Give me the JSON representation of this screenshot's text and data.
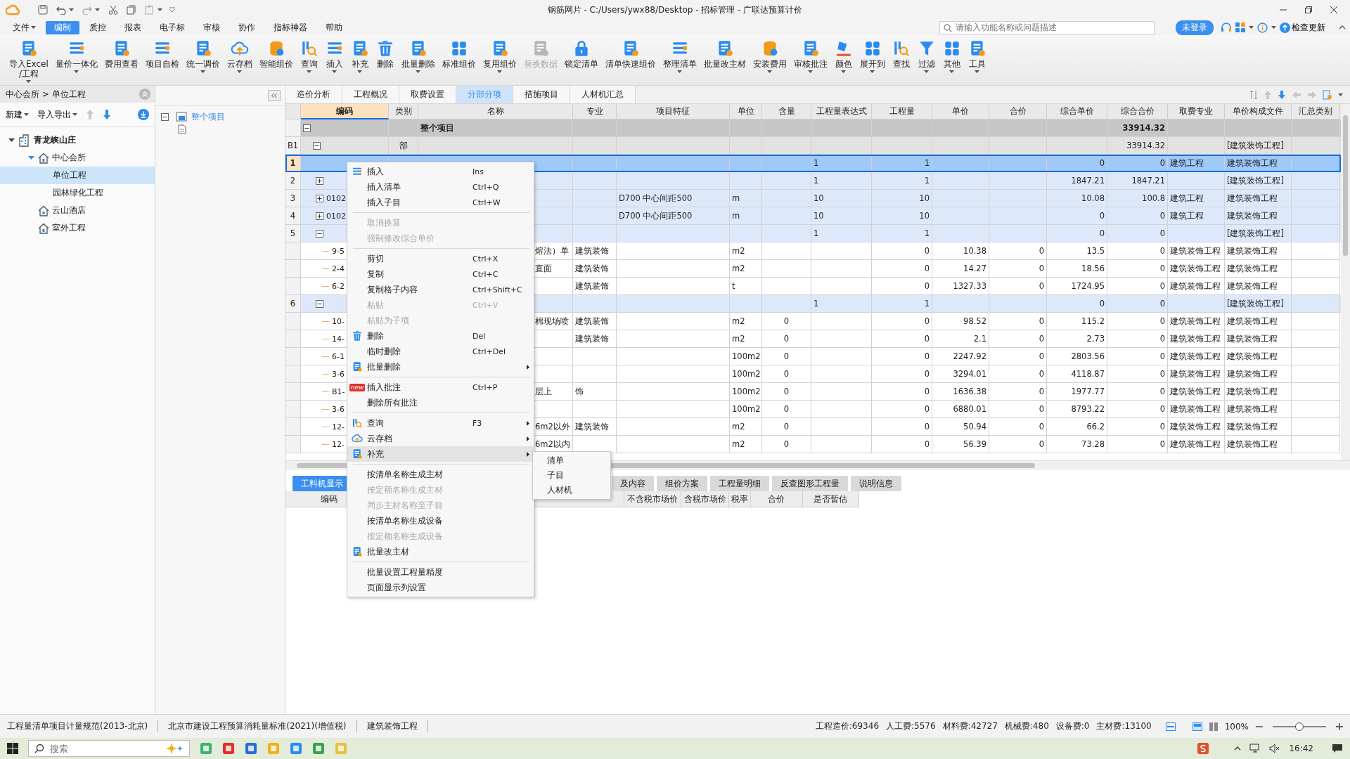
{
  "title_bar": {
    "title": "钢筋网片 - C:/Users/ywx88/Desktop - 招标管理 - 广联达预算计价"
  },
  "menu_tabs": [
    {
      "label": "文件",
      "selected": false,
      "dropdown": true
    },
    {
      "label": "编制",
      "selected": true,
      "dropdown": false
    },
    {
      "label": "质控",
      "selected": false,
      "dropdown": false
    },
    {
      "label": "报表",
      "selected": false,
      "dropdown": false
    },
    {
      "label": "电子标",
      "selected": false,
      "dropdown": false
    },
    {
      "label": "审核",
      "selected": false,
      "dropdown": false
    },
    {
      "label": "协作",
      "selected": false,
      "dropdown": false
    },
    {
      "label": "指标神器",
      "selected": false,
      "dropdown": false
    },
    {
      "label": "帮助",
      "selected": false,
      "dropdown": false
    }
  ],
  "search": {
    "placeholder": "请输入功能名称或问题描述"
  },
  "login_button": "未登录",
  "update_button": "检查更新",
  "ribbon": [
    {
      "label": "导入Excel\n/工程",
      "dropdown": true,
      "disabled": false
    },
    {
      "label": "量价一体化",
      "dropdown": true,
      "disabled": false
    },
    {
      "label": "费用查看",
      "dropdown": false,
      "disabled": false
    },
    {
      "label": "项目自检",
      "dropdown": false,
      "disabled": false
    },
    {
      "label": "统一调价",
      "dropdown": true,
      "disabled": false
    },
    {
      "label": "云存档",
      "dropdown": true,
      "disabled": false
    },
    {
      "label": "智能组价",
      "dropdown": false,
      "disabled": false
    },
    {
      "label": "查询",
      "dropdown": true,
      "disabled": false
    },
    {
      "label": "插入",
      "dropdown": true,
      "disabled": false
    },
    {
      "label": "补充",
      "dropdown": true,
      "disabled": false
    },
    {
      "label": "删除",
      "dropdown": false,
      "disabled": false
    },
    {
      "label": "批量删除",
      "dropdown": true,
      "disabled": false
    },
    {
      "label": "标准组价",
      "dropdown": false,
      "disabled": false
    },
    {
      "label": "复用组价",
      "dropdown": true,
      "disabled": false
    },
    {
      "label": "替换数据",
      "dropdown": false,
      "disabled": true
    },
    {
      "label": "锁定清单",
      "dropdown": false,
      "disabled": false
    },
    {
      "label": "清单快速组价",
      "dropdown": false,
      "disabled": false
    },
    {
      "label": "整理清单",
      "dropdown": true,
      "disabled": false
    },
    {
      "label": "批量改主材",
      "dropdown": false,
      "disabled": false
    },
    {
      "label": "安装费用",
      "dropdown": true,
      "disabled": false
    },
    {
      "label": "审核批注",
      "dropdown": true,
      "disabled": false
    },
    {
      "label": "颜色",
      "dropdown": true,
      "disabled": false
    },
    {
      "label": "展开到",
      "dropdown": true,
      "disabled": false
    },
    {
      "label": "查找",
      "dropdown": false,
      "disabled": false
    },
    {
      "label": "过滤",
      "dropdown": true,
      "disabled": false
    },
    {
      "label": "其他",
      "dropdown": true,
      "disabled": false
    },
    {
      "label": "工具",
      "dropdown": true,
      "disabled": false
    }
  ],
  "breadcrumb": "中心会所 > 单位工程",
  "left_toolbar": [
    {
      "label": "新建"
    },
    {
      "label": "导入导出"
    }
  ],
  "project_tree": [
    {
      "label": "青龙峡山庄",
      "selected": false,
      "expanded": true,
      "children": [
        {
          "label": "中心会所",
          "selected": false,
          "expanded": true,
          "children": [
            {
              "label": "单位工程",
              "selected": true
            },
            {
              "label": "园林绿化工程",
              "selected": false
            }
          ]
        },
        {
          "label": "云山酒店",
          "selected": false
        },
        {
          "label": "室外工程",
          "selected": false
        }
      ]
    }
  ],
  "section_tree": {
    "label": "整个项目",
    "expanded": true
  },
  "view_tabs": [
    {
      "label": "造价分析",
      "selected": false
    },
    {
      "label": "工程概况",
      "selected": false
    },
    {
      "label": "取费设置",
      "selected": false
    },
    {
      "label": "分部分项",
      "selected": true
    },
    {
      "label": "措施项目",
      "selected": false
    },
    {
      "label": "人材机汇总",
      "selected": false
    }
  ],
  "table": {
    "columns": [
      {
        "label": "编码",
        "selected": true
      },
      {
        "label": "类别",
        "selected": false
      },
      {
        "label": "名称",
        "selected": false
      },
      {
        "label": "专业",
        "selected": false
      },
      {
        "label": "项目特征",
        "selected": false
      },
      {
        "label": "单位",
        "selected": false
      },
      {
        "label": "含量",
        "selected": false
      },
      {
        "label": "工程量表达式",
        "selected": false
      },
      {
        "label": "工程量",
        "selected": false
      },
      {
        "label": "单价",
        "selected": false
      },
      {
        "label": "合价",
        "selected": false
      },
      {
        "label": "综合单价",
        "selected": false
      },
      {
        "label": "综合合价",
        "selected": false
      },
      {
        "label": "取费专业",
        "selected": false
      },
      {
        "label": "单价构成文件",
        "selected": false
      },
      {
        "label": "汇总类别",
        "selected": false
      }
    ],
    "rows": [
      {
        "kind": "root",
        "selected": false,
        "expanded": true,
        "name": "整个项目",
        "unit_total": "33914.32"
      },
      {
        "kind": "part",
        "number": "B1",
        "selected": false,
        "expanded": true,
        "category": "部",
        "unit_total": "33914.32",
        "price_file": "[建筑装饰工程]"
      },
      {
        "kind": "item",
        "number": "1",
        "selected": true,
        "expr": "1",
        "qty": "1",
        "unit_price": "0",
        "unit_total": "0",
        "fee_specialty": "建筑工程",
        "price_file": "建筑装饰工程"
      },
      {
        "kind": "item",
        "number": "2",
        "selected": false,
        "expanded": false,
        "expr": "1",
        "qty": "1",
        "unit_price": "1847.21",
        "unit_total": "1847.21",
        "price_file": "[建筑装饰工程]"
      },
      {
        "kind": "item",
        "number": "3",
        "selected": false,
        "expanded": false,
        "code": "0102",
        "feature": "D700 中心间距500",
        "unit": "m",
        "expr": "10",
        "qty": "10",
        "unit_price": "10.08",
        "unit_total": "100.8",
        "fee_specialty": "建筑工程",
        "price_file": "建筑装饰工程"
      },
      {
        "kind": "item",
        "number": "4",
        "selected": false,
        "expanded": false,
        "code": "0102",
        "feature": "D700 中心间距500",
        "unit": "m",
        "expr": "10",
        "qty": "10",
        "unit_price": "0",
        "unit_total": "0",
        "fee_specialty": "建筑工程",
        "price_file": "建筑装饰工程"
      },
      {
        "kind": "item",
        "number": "5",
        "selected": false,
        "expanded": true,
        "expr": "1",
        "qty": "1",
        "unit_price": "0",
        "unit_total": "0",
        "price_file": "[建筑装饰工程]"
      },
      {
        "kind": "sub",
        "selected": false,
        "code": "9-5",
        "name": "熔法）单",
        "specialty": "建筑装饰",
        "unit": "m2",
        "qty": "0",
        "price": "10.38",
        "total": "0",
        "unit_price": "13.5",
        "unit_total": "0",
        "fee_specialty": "建筑装饰工程",
        "price_file": "建筑装饰工程"
      },
      {
        "kind": "sub",
        "selected": false,
        "code": "2-4",
        "name": "直面",
        "specialty": "建筑装饰",
        "unit": "m2",
        "qty": "0",
        "price": "14.27",
        "total": "0",
        "unit_price": "18.56",
        "unit_total": "0",
        "fee_specialty": "建筑装饰工程",
        "price_file": "建筑装饰工程"
      },
      {
        "kind": "sub",
        "selected": false,
        "code": "6-2",
        "specialty": "建筑装饰",
        "unit": "t",
        "qty": "0",
        "price": "1327.33",
        "total": "0",
        "unit_price": "1724.95",
        "unit_total": "0",
        "fee_specialty": "建筑装饰工程",
        "price_file": "建筑装饰工程"
      },
      {
        "kind": "item",
        "number": "6",
        "selected": false,
        "expanded": true,
        "expr": "1",
        "qty": "1",
        "unit_price": "0",
        "unit_total": "0",
        "price_file": "[建筑装饰工程]"
      },
      {
        "kind": "sub",
        "selected": false,
        "code": "10-",
        "name": "棉现场喷",
        "specialty": "建筑装饰",
        "unit": "m2",
        "content": "0",
        "qty": "0",
        "price": "98.52",
        "total": "0",
        "unit_price": "115.2",
        "unit_total": "0",
        "fee_specialty": "建筑装饰工程",
        "price_file": "建筑装饰工程"
      },
      {
        "kind": "sub",
        "selected": false,
        "code": "14-",
        "specialty": "建筑装饰",
        "unit": "m2",
        "content": "0",
        "qty": "0",
        "price": "2.1",
        "total": "0",
        "unit_price": "2.73",
        "unit_total": "0",
        "fee_specialty": "建筑装饰工程",
        "price_file": "建筑装饰工程"
      },
      {
        "kind": "sub",
        "selected": false,
        "code": "6-1",
        "unit": "100m2",
        "content": "0",
        "qty": "0",
        "price": "2247.92",
        "total": "0",
        "unit_price": "2803.56",
        "unit_total": "0",
        "fee_specialty": "建筑装饰工程",
        "price_file": "建筑装饰工程"
      },
      {
        "kind": "sub",
        "selected": false,
        "code": "3-6",
        "unit": "100m2",
        "content": "0",
        "qty": "0",
        "price": "3294.01",
        "total": "0",
        "unit_price": "4118.87",
        "unit_total": "0",
        "fee_specialty": "建筑装饰工程",
        "price_file": "建筑装饰工程"
      },
      {
        "kind": "sub",
        "selected": false,
        "code": "B1-",
        "name": "层上",
        "specialty": "饰",
        "unit": "100m2",
        "content": "0",
        "qty": "0",
        "price": "1636.38",
        "total": "0",
        "unit_price": "1977.77",
        "unit_total": "0",
        "fee_specialty": "建筑装饰工程",
        "price_file": "建筑装饰工程"
      },
      {
        "kind": "sub",
        "selected": false,
        "code": "3-6",
        "unit": "100m2",
        "content": "0",
        "qty": "0",
        "price": "6880.01",
        "total": "0",
        "unit_price": "8793.22",
        "unit_total": "0",
        "fee_specialty": "建筑装饰工程",
        "price_file": "建筑装饰工程"
      },
      {
        "kind": "sub",
        "selected": false,
        "code": "12-",
        "name": "6m2以外",
        "specialty": "建筑装饰",
        "unit": "m2",
        "content": "0",
        "qty": "0",
        "price": "50.94",
        "total": "0",
        "unit_price": "66.2",
        "unit_total": "0",
        "fee_specialty": "建筑装饰工程",
        "price_file": "建筑装饰工程"
      },
      {
        "kind": "sub",
        "selected": false,
        "code": "12-",
        "name": "6m2以内",
        "unit": "m2",
        "content": "0",
        "qty": "0",
        "price": "56.39",
        "total": "0",
        "unit_price": "73.28",
        "unit_total": "0",
        "fee_specialty": "建筑装饰工程",
        "price_file": "建筑装饰工程"
      }
    ]
  },
  "bottom_tabs": [
    {
      "label": "工料机显示",
      "selected": true
    },
    {
      "label": "及内容",
      "selected": false
    },
    {
      "label": "组价方案",
      "selected": false
    },
    {
      "label": "工程量明细",
      "selected": false
    },
    {
      "label": "反查图形工程量",
      "selected": false
    },
    {
      "label": "说明信息",
      "selected": false
    }
  ],
  "bottom_columns": [
    "编码",
    "不含税市场价",
    "含税市场价",
    "税率",
    "合价",
    "是否暂估"
  ],
  "context_menu": [
    {
      "kind": "item",
      "label": "插入",
      "shortcut": "Ins",
      "disabled": false,
      "submenu": false,
      "selected": false
    },
    {
      "kind": "item",
      "label": "插入清单",
      "shortcut": "Ctrl+Q",
      "disabled": false,
      "submenu": false,
      "selected": false
    },
    {
      "kind": "item",
      "label": "插入子目",
      "shortcut": "Ctrl+W",
      "disabled": false,
      "submenu": false,
      "selected": false
    },
    {
      "kind": "separator"
    },
    {
      "kind": "item",
      "label": "取消换算",
      "disabled": true,
      "submenu": false,
      "selected": false
    },
    {
      "kind": "item",
      "label": "强制修改综合单价",
      "disabled": true,
      "submenu": false,
      "selected": false
    },
    {
      "kind": "separator"
    },
    {
      "kind": "item",
      "label": "剪切",
      "shortcut": "Ctrl+X",
      "disabled": false,
      "submenu": false,
      "selected": false
    },
    {
      "kind": "item",
      "label": "复制",
      "shortcut": "Ctrl+C",
      "disabled": false,
      "submenu": false,
      "selected": false
    },
    {
      "kind": "item",
      "label": "复制格子内容",
      "shortcut": "Ctrl+Shift+C",
      "disabled": false,
      "submenu": false,
      "selected": false
    },
    {
      "kind": "item",
      "label": "粘贴",
      "shortcut": "Ctrl+V",
      "disabled": true,
      "submenu": false,
      "selected": false
    },
    {
      "kind": "item",
      "label": "粘贴为子项",
      "disabled": true,
      "submenu": false,
      "selected": false
    },
    {
      "kind": "item",
      "label": "删除",
      "shortcut": "Del",
      "disabled": false,
      "submenu": false,
      "selected": false
    },
    {
      "kind": "item",
      "label": "临时删除",
      "shortcut": "Ctrl+Del",
      "disabled": false,
      "submenu": false,
      "selected": false
    },
    {
      "kind": "item",
      "label": "批量删除",
      "disabled": false,
      "submenu": true,
      "selected": false
    },
    {
      "kind": "separator"
    },
    {
      "kind": "item",
      "label": "插入批注",
      "shortcut": "Ctrl+P",
      "badge": "new",
      "disabled": false,
      "submenu": false,
      "selected": false
    },
    {
      "kind": "item",
      "label": "删除所有批注",
      "disabled": false,
      "submenu": false,
      "selected": false
    },
    {
      "kind": "separator"
    },
    {
      "kind": "item",
      "label": "查询",
      "shortcut": "F3",
      "disabled": false,
      "submenu": true,
      "selected": false
    },
    {
      "kind": "item",
      "label": "云存档",
      "disabled": false,
      "submenu": true,
      "selected": false
    },
    {
      "kind": "item",
      "label": "补充",
      "disabled": false,
      "submenu": true,
      "selected": true
    },
    {
      "kind": "separator"
    },
    {
      "kind": "item",
      "label": "按清单名称生成主材",
      "disabled": false,
      "submenu": false,
      "selected": false
    },
    {
      "kind": "item",
      "label": "按定额名称生成主材",
      "disabled": true,
      "submenu": false,
      "selected": false
    },
    {
      "kind": "item",
      "label": "同步主材名称至子目",
      "disabled": true,
      "submenu": false,
      "selected": false
    },
    {
      "kind": "item",
      "label": "按清单名称生成设备",
      "disabled": false,
      "submenu": false,
      "selected": false
    },
    {
      "kind": "item",
      "label": "按定额名称生成设备",
      "disabled": true,
      "submenu": false,
      "selected": false
    },
    {
      "kind": "item",
      "label": "批量改主材",
      "disabled": false,
      "submenu": false,
      "selected": false
    },
    {
      "kind": "separator"
    },
    {
      "kind": "item",
      "label": "批量设置工程量精度",
      "disabled": false,
      "submenu": false,
      "selected": false
    },
    {
      "kind": "item",
      "label": "页面显示列设置",
      "disabled": false,
      "submenu": false,
      "selected": false
    }
  ],
  "submenu": [
    {
      "label": "清单"
    },
    {
      "label": "子目"
    },
    {
      "label": "人材机"
    }
  ],
  "status_bar": {
    "left": [
      "工程量清单项目计量规范(2013-北京)",
      "北京市建设工程预算消耗量标准(2021)(增值税)",
      "建筑装饰工程"
    ],
    "right": [
      "工程造价:69346",
      "人工费:5576",
      "材料费:42727",
      "机械费:480",
      "设备费:0",
      "主材费:13100"
    ],
    "zoom": {
      "reading": "100%",
      "level": 0.5
    }
  },
  "taskbar": {
    "search_placeholder": "搜索",
    "time": "16:42"
  }
}
